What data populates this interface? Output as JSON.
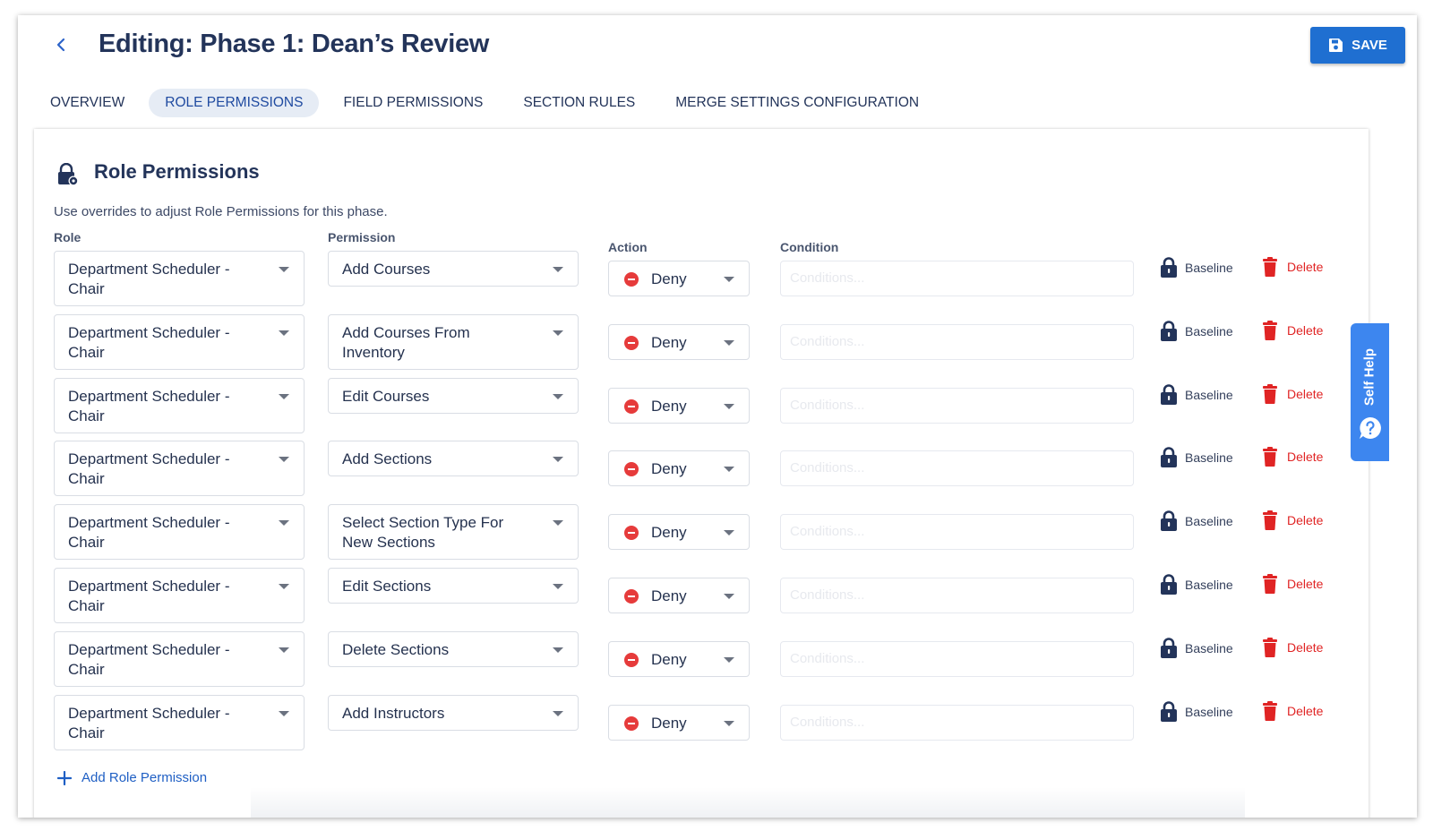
{
  "header": {
    "title": "Editing: Phase 1: Dean’s Review",
    "save_label": "SAVE"
  },
  "tabs": [
    {
      "label": "OVERVIEW",
      "active": false
    },
    {
      "label": "ROLE PERMISSIONS",
      "active": true
    },
    {
      "label": "FIELD PERMISSIONS",
      "active": false
    },
    {
      "label": "SECTION RULES",
      "active": false
    },
    {
      "label": "MERGE SETTINGS CONFIGURATION",
      "active": false
    }
  ],
  "section": {
    "title": "Role Permissions",
    "description": "Use overrides to adjust Role Permissions for this phase.",
    "headers": {
      "role": "Role",
      "permission": "Permission",
      "action": "Action",
      "condition": "Condition"
    }
  },
  "rows": [
    {
      "role": [
        "Department Scheduler -",
        "Chair"
      ],
      "permission": [
        "Add Courses"
      ],
      "action": "Deny",
      "condition_placeholder": "Conditions...",
      "baseline": "Baseline",
      "delete": "Delete"
    },
    {
      "role": [
        "Department Scheduler -",
        "Chair"
      ],
      "permission": [
        "Add Courses From",
        "Inventory"
      ],
      "action": "Deny",
      "condition_placeholder": "Conditions...",
      "baseline": "Baseline",
      "delete": "Delete"
    },
    {
      "role": [
        "Department Scheduler -",
        "Chair"
      ],
      "permission": [
        "Edit Courses"
      ],
      "action": "Deny",
      "condition_placeholder": "Conditions...",
      "baseline": "Baseline",
      "delete": "Delete"
    },
    {
      "role": [
        "Department Scheduler -",
        "Chair"
      ],
      "permission": [
        "Add Sections"
      ],
      "action": "Deny",
      "condition_placeholder": "Conditions...",
      "baseline": "Baseline",
      "delete": "Delete"
    },
    {
      "role": [
        "Department Scheduler -",
        "Chair"
      ],
      "permission": [
        "Select Section Type For",
        "New Sections"
      ],
      "action": "Deny",
      "condition_placeholder": "Conditions...",
      "baseline": "Baseline",
      "delete": "Delete"
    },
    {
      "role": [
        "Department Scheduler -",
        "Chair"
      ],
      "permission": [
        "Edit Sections"
      ],
      "action": "Deny",
      "condition_placeholder": "Conditions...",
      "baseline": "Baseline",
      "delete": "Delete"
    },
    {
      "role": [
        "Department Scheduler -",
        "Chair"
      ],
      "permission": [
        "Delete Sections"
      ],
      "action": "Deny",
      "condition_placeholder": "Conditions...",
      "baseline": "Baseline",
      "delete": "Delete"
    },
    {
      "role": [
        "Department Scheduler -",
        "Chair"
      ],
      "permission": [
        "Add Instructors"
      ],
      "action": "Deny",
      "condition_placeholder": "Conditions...",
      "baseline": "Baseline",
      "delete": "Delete"
    }
  ],
  "add_role_label": "Add Role Permission",
  "self_help_label": "Self Help",
  "icons": {
    "back": "chevron-left-icon",
    "save": "floppy-disk-icon",
    "section": "lock-gear-icon",
    "action": "minus-circle-icon",
    "baseline": "lock-icon",
    "delete": "trash-icon",
    "add": "plus-icon",
    "help": "question-bubble-icon"
  },
  "colors": {
    "primary": "#1f6fd1",
    "title": "#23345a",
    "deny": "#e63b3b",
    "delete": "#e02424",
    "self_help": "#3d86ef",
    "active_tab_bg": "#e6ecf5"
  }
}
